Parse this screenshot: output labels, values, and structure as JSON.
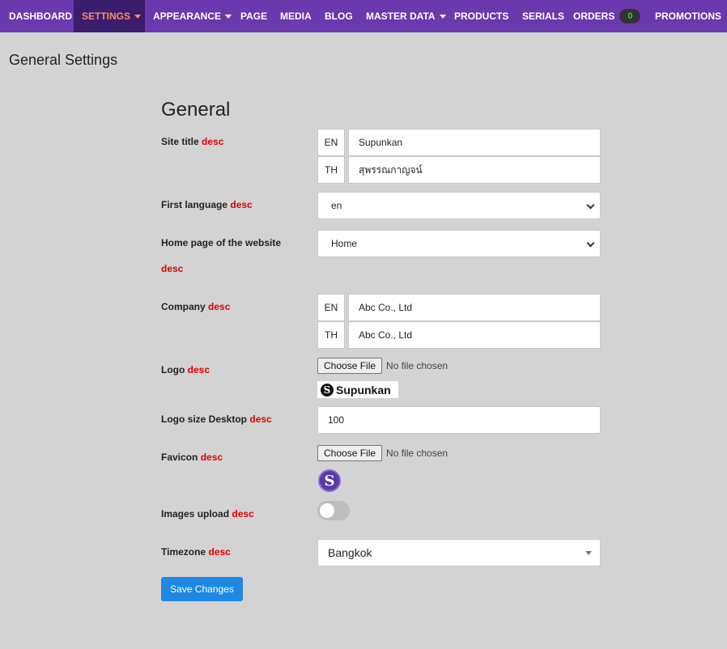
{
  "nav": {
    "items": [
      {
        "label": "DASHBOARD"
      },
      {
        "label": "SETTINGS",
        "active": true,
        "dropdown": true
      },
      {
        "label": "APPEARANCE",
        "dropdown": true
      },
      {
        "label": "PAGE"
      },
      {
        "label": "MEDIA"
      },
      {
        "label": "BLOG"
      },
      {
        "label": "MASTER DATA",
        "dropdown": true
      },
      {
        "label": "PRODUCTS"
      },
      {
        "label": "SERIALS"
      },
      {
        "label": "ORDERS",
        "badge": "0"
      },
      {
        "label": "PROMOTIONS"
      }
    ]
  },
  "page": {
    "title": "General Settings",
    "section_title": "General"
  },
  "form": {
    "desc": "desc",
    "site_title": {
      "label": "Site title",
      "en_tag": "EN",
      "en_value": "Supunkan",
      "th_tag": "TH",
      "th_value": "สุพรรณกาญจน์"
    },
    "first_language": {
      "label": "First language",
      "value": "en"
    },
    "home_page": {
      "label": "Home page of the website",
      "value": "Home"
    },
    "company": {
      "label": "Company",
      "en_tag": "EN",
      "en_value": "Abc Co., Ltd",
      "th_tag": "TH",
      "th_value": "Abc Co., Ltd"
    },
    "logo": {
      "label": "Logo",
      "button": "Choose File",
      "status": "No file chosen",
      "preview_text": "Supunkan",
      "preview_letter": "S"
    },
    "logo_size": {
      "label": "Logo size Desktop",
      "value": "100"
    },
    "favicon": {
      "label": "Favicon",
      "button": "Choose File",
      "status": "No file chosen",
      "preview_letter": "S"
    },
    "images_upload": {
      "label": "Images upload",
      "enabled": false
    },
    "timezone": {
      "label": "Timezone",
      "value": "Bangkok"
    },
    "save_label": "Save Changes"
  },
  "colors": {
    "nav_bg": "#6a39ad",
    "nav_active_bg": "#3a1d6d",
    "nav_active_text": "#ff8c66",
    "desc": "#e00000",
    "primary": "#1e88e5"
  }
}
